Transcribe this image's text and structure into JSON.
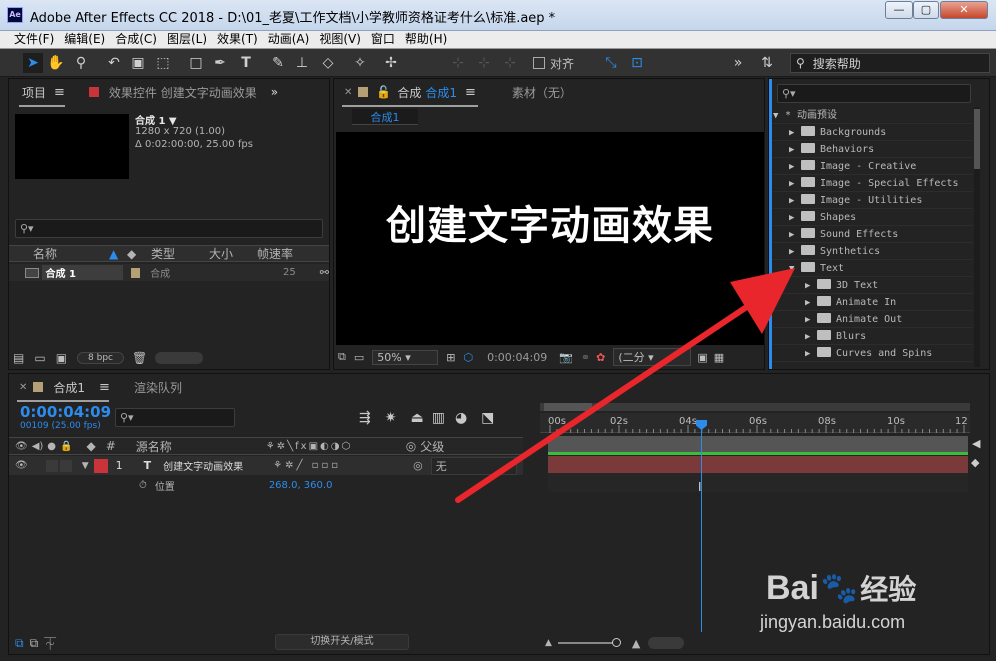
{
  "window": {
    "title": "Adobe After Effects CC 2018 - D:\\01_老夏\\工作文档\\小学教师资格证考什么\\标准.aep *",
    "app_icon": "Ae",
    "min": "—",
    "max": "▢",
    "close": "✕"
  },
  "menu": [
    "文件(F)",
    "编辑(E)",
    "合成(C)",
    "图层(L)",
    "效果(T)",
    "动画(A)",
    "视图(V)",
    "窗口",
    "帮助(H)"
  ],
  "toolbar": {
    "snap_label": "对齐",
    "search_help": "搜索帮助",
    "more": "»"
  },
  "project_panel": {
    "tab_project": "项目",
    "tab_effects": "效果控件 创建文字动画效果",
    "comp_name": "合成 1 ▼",
    "comp_res": "1280 x 720 (1.00)",
    "comp_dur": "Δ 0:02:00:00, 25.00 fps",
    "columns": [
      "名称",
      "类型",
      "大小",
      "帧速率"
    ],
    "rows": [
      {
        "name": "合成 1",
        "type": "合成",
        "size": "",
        "fps": "25"
      }
    ],
    "bpc": "8 bpc"
  },
  "comp_panel": {
    "tab_comp": "合成",
    "tab_comp_active": "合成1",
    "tab_footage": "素材（无）",
    "sub_tab": "合成1",
    "canvas_text": "创建文字动画效果",
    "zoom": "50%",
    "timecode": "0:00:04:09",
    "quality": "(二分"
  },
  "effects_presets": {
    "root": "* 动画预设",
    "items": [
      {
        "label": "Backgrounds",
        "depth": 1,
        "open": false
      },
      {
        "label": "Behaviors",
        "depth": 1,
        "open": false
      },
      {
        "label": "Image - Creative",
        "depth": 1,
        "open": false
      },
      {
        "label": "Image - Special Effects",
        "depth": 1,
        "open": false
      },
      {
        "label": "Image - Utilities",
        "depth": 1,
        "open": false
      },
      {
        "label": "Shapes",
        "depth": 1,
        "open": false
      },
      {
        "label": "Sound Effects",
        "depth": 1,
        "open": false
      },
      {
        "label": "Synthetics",
        "depth": 1,
        "open": false
      },
      {
        "label": "Text",
        "depth": 1,
        "open": true
      },
      {
        "label": "3D Text",
        "depth": 2,
        "open": false
      },
      {
        "label": "Animate In",
        "depth": 2,
        "open": false
      },
      {
        "label": "Animate Out",
        "depth": 2,
        "open": false
      },
      {
        "label": "Blurs",
        "depth": 2,
        "open": false
      },
      {
        "label": "Curves and Spins",
        "depth": 2,
        "open": false
      }
    ]
  },
  "timeline": {
    "tab_comp": "合成1",
    "tab_render": "渲染队列",
    "timecode": "0:00:04:09",
    "frame_info": "00109 (25.00 fps)",
    "col_source": "源名称",
    "col_parent": "父级",
    "layer_num": "1",
    "layer_type": "T",
    "layer_name": "创建文字动画效果",
    "parent_value": "无",
    "prop_name": "位置",
    "prop_value": "268.0, 360.0",
    "switch_mode": "切换开关/模式",
    "ruler": [
      "00s",
      "02s",
      "04s",
      "06s",
      "08s",
      "10s",
      "12"
    ],
    "playhead_time_fraction": 0.369
  },
  "watermark": {
    "brand": "Bai",
    "brand2": "经验",
    "url": "jingyan.baidu.com"
  },
  "colors": {
    "accent_blue": "#2d8ceb",
    "layer_red": "#c8343a",
    "arrow_red": "#e8262b",
    "track_bar": "#7a3a3a"
  }
}
